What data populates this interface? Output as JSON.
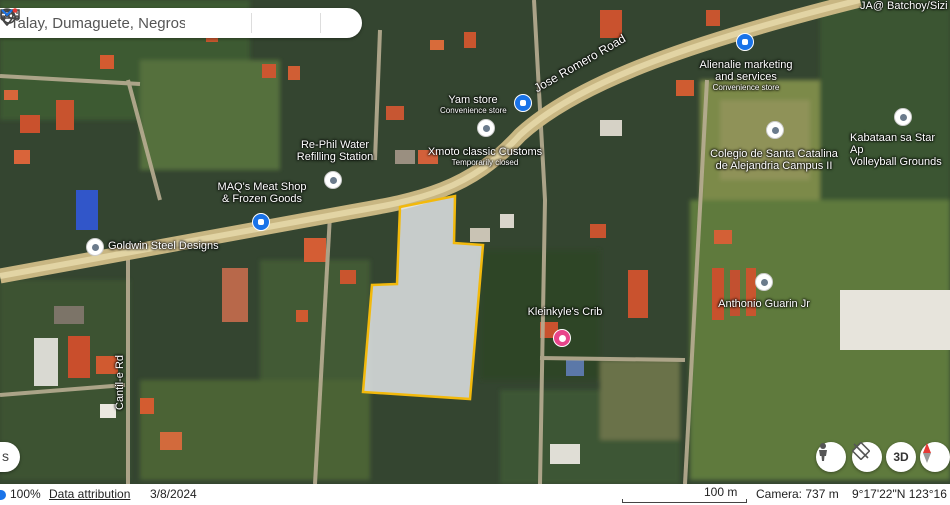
{
  "search": {
    "value": "Talay, Dumaguete, Negros Oriental"
  },
  "map_labels": {
    "jose_romero_road": "Jose Romero Road",
    "cantil_e_rd": "Cantil-e Rd",
    "top_right_cut": "JA@ Batchoy/Sizi"
  },
  "places": [
    {
      "name": "Alienalie marketing\nand services",
      "sub": "Convenience store",
      "icon": "shopping-bag-icon"
    },
    {
      "name": "Yam store",
      "sub": "Convenience store",
      "icon": "shopping-bag-icon"
    },
    {
      "name": "Kabataan sa Star Ap\nVolleyball Grounds",
      "sub": "",
      "icon": "place-icon"
    },
    {
      "name": "Re-Phil Water\nRefilling Station",
      "sub": "",
      "icon": "place-icon"
    },
    {
      "name": "Xmoto classic Customs",
      "sub": "Temporarily closed",
      "icon": "place-icon"
    },
    {
      "name": "Colegio de Santa Catalina\nde Alejandria Campus II",
      "sub": "",
      "icon": "school-icon"
    },
    {
      "name": "MAQ's Meat Shop\n& Frozen Goods",
      "sub": "",
      "icon": "shopping-cart-icon"
    },
    {
      "name": "Goldwin Steel Designs",
      "sub": "",
      "icon": "place-icon"
    },
    {
      "name": "Anthonio Guarin Jr",
      "sub": "",
      "icon": "place-icon"
    },
    {
      "name": "Kleinkyle's Crib",
      "sub": "",
      "icon": "hotel-icon"
    }
  ],
  "controls": {
    "view3d": "3D"
  },
  "status": {
    "zoom": "100%",
    "attribution": "Data attribution",
    "date": "3/8/2024",
    "scale": "100 m",
    "camera": "Camera: 737 m",
    "coords": "9°17'22\"N 123°16"
  },
  "colors": {
    "highlight": "#f2b90c",
    "accent": "#1a73e8",
    "road": "#d8c58a"
  }
}
